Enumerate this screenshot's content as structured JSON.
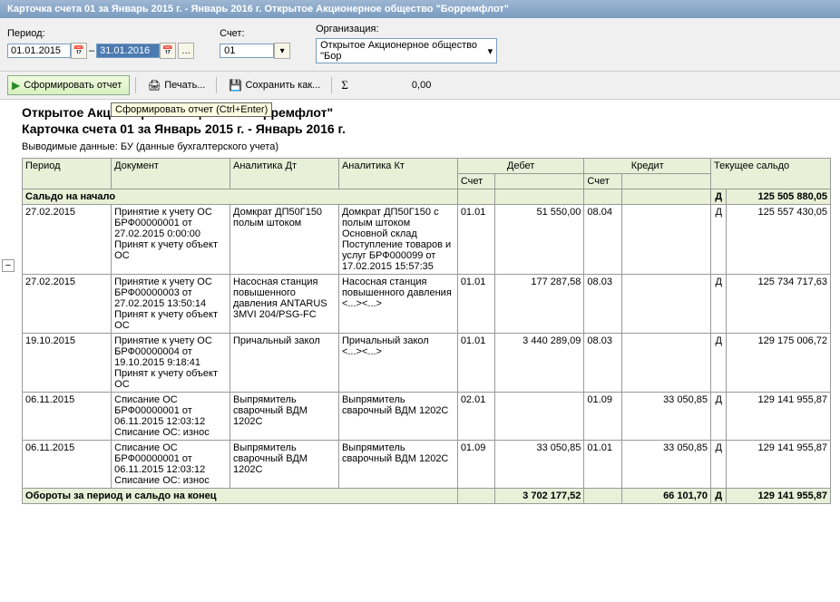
{
  "window_title": "Карточка счета 01 за Январь 2015 г. - Январь 2016 г. Открытое Акционерное общество \"Борремфлот\"",
  "labels": {
    "period": "Период:",
    "account": "Счет:",
    "org": "Организация:"
  },
  "period_from": "01.01.2015",
  "period_to": "31.01.2016",
  "account": "01",
  "organization": "Открытое Акционерное общество \"Бор",
  "toolbar": {
    "form_report": "Сформировать отчет",
    "print": "Печать...",
    "save_as": "Сохранить как...",
    "zero": "0,00"
  },
  "tooltip": "Сформировать отчет (Ctrl+Enter)",
  "report_header": {
    "org": "Открытое Акционерное общество \"Борремфлот\"",
    "title": "Карточка счета 01 за Январь 2015 г. - Январь 2016 г.",
    "subtitle": "Выводимые данные:   БУ (данные бухгалтерского учета)"
  },
  "columns": {
    "period": "Период",
    "document": "Документ",
    "analytics_d": "Аналитика Дт",
    "analytics_k": "Аналитика Кт",
    "debit": "Дебет",
    "credit": "Кредит",
    "balance": "Текущее сальдо",
    "account_sub": "Счет"
  },
  "opening_row": {
    "label": "Сальдо на начало",
    "dk": "Д",
    "balance": "125 505 880,05"
  },
  "rows": [
    {
      "period": "27.02.2015",
      "document": "Принятие к учету ОС БРФ00000001 от 27.02.2015 0:00:00\nПринят к учету объект ОС",
      "an_d": "Домкрат ДП50Г150 полым штоком",
      "an_k": "Домкрат ДП50Г150 с полым штоком\nОсновной склад\nПоступление товаров и услуг БРФ000099 от 17.02.2015 15:57:35",
      "d_acc": "01.01",
      "d_sum": "51 550,00",
      "k_acc": "08.04",
      "k_sum": "",
      "dk": "Д",
      "balance": "125 557 430,05"
    },
    {
      "period": "27.02.2015",
      "document": "Принятие к учету ОС БРФ00000003 от 27.02.2015 13:50:14\nПринят к учету объект ОС",
      "an_d": "Насосная станция повышенного давления ANTARUS 3MVI 204/PSG-FC",
      "an_k": "Насосная станция повышенного давления\n<...><...>",
      "d_acc": "01.01",
      "d_sum": "177 287,58",
      "k_acc": "08.03",
      "k_sum": "",
      "dk": "Д",
      "balance": "125 734 717,63"
    },
    {
      "period": "19.10.2015",
      "document": "Принятие к учету ОС БРФ00000004 от 19.10.2015 9:18:41\nПринят к учету объект ОС",
      "an_d": "Причальный закол",
      "an_k": "Причальный закол\n<...><...>",
      "d_acc": "01.01",
      "d_sum": "3 440 289,09",
      "k_acc": "08.03",
      "k_sum": "",
      "dk": "Д",
      "balance": "129 175 006,72"
    },
    {
      "period": "06.11.2015",
      "document": "Списание ОС БРФ00000001 от 06.11.2015 12:03:12\nСписание ОС: износ",
      "an_d": "Выпрямитель сварочный ВДМ 1202С",
      "an_k": "Выпрямитель сварочный ВДМ 1202С",
      "d_acc": "02.01",
      "d_sum": "",
      "k_acc": "01.09",
      "k_sum": "33 050,85",
      "dk": "Д",
      "balance": "129 141 955,87"
    },
    {
      "period": "06.11.2015",
      "document": "Списание ОС БРФ00000001 от 06.11.2015 12:03:12\nСписание ОС: износ",
      "an_d": "Выпрямитель сварочный ВДМ 1202С",
      "an_k": "Выпрямитель сварочный ВДМ 1202С",
      "d_acc": "01.09",
      "d_sum": "33 050,85",
      "k_acc": "01.01",
      "k_sum": "33 050,85",
      "dk": "Д",
      "balance": "129 141 955,87"
    }
  ],
  "closing_row": {
    "label": "Обороты за период и сальдо на конец",
    "d_sum": "3 702 177,52",
    "k_sum": "66 101,70",
    "dk": "Д",
    "balance": "129 141 955,87"
  }
}
